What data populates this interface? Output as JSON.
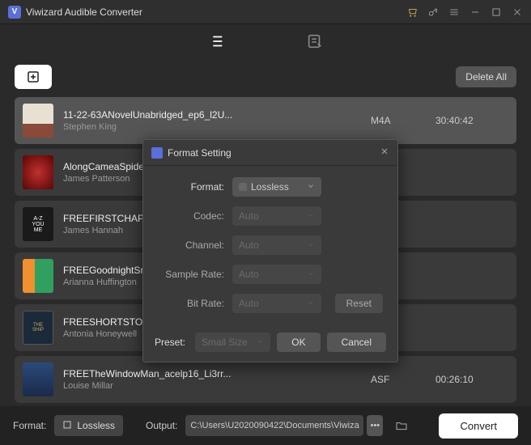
{
  "app": {
    "title": "Viwizard Audible Converter"
  },
  "actions": {
    "delete_all": "Delete All"
  },
  "list": [
    {
      "title": "11-22-63ANovelUnabridged_ep6_l2U...",
      "author": "Stephen King",
      "format": "M4A",
      "duration": "30:40:42",
      "thumb": "th1",
      "selected": true
    },
    {
      "title": "AlongCameaSpider",
      "author": "James Patterson",
      "format": "",
      "duration": "",
      "thumb": "th2"
    },
    {
      "title": "FREEFIRSTCHAPTER",
      "author": "James Hannah",
      "format": "",
      "duration": "",
      "thumb": "th3"
    },
    {
      "title": "FREEGoodnightSmartphone",
      "author": "Arianna Huffington",
      "format": "",
      "duration": "",
      "thumb": "th4"
    },
    {
      "title": "FREESHORTSTORY",
      "author": "Antonia Honeywell",
      "format": "",
      "duration": "",
      "thumb": "th5"
    },
    {
      "title": "FREETheWindowMan_acelp16_Li3rr...",
      "author": "Louise Millar",
      "format": "ASF",
      "duration": "00:26:10",
      "thumb": "th6"
    }
  ],
  "bottom": {
    "format_label": "Format:",
    "format_value": "Lossless",
    "output_label": "Output:",
    "output_path": "C:\\Users\\U2020090422\\Documents\\Viwiza",
    "convert": "Convert"
  },
  "modal": {
    "title": "Format Setting",
    "rows": {
      "format_label": "Format:",
      "format_value": "Lossless",
      "codec_label": "Codec:",
      "codec_value": "Auto",
      "channel_label": "Channel:",
      "channel_value": "Auto",
      "samplerate_label": "Sample Rate:",
      "samplerate_value": "Auto",
      "bitrate_label": "Bit Rate:",
      "bitrate_value": "Auto"
    },
    "reset": "Reset",
    "preset_label": "Preset:",
    "preset_value": "Small Size",
    "ok": "OK",
    "cancel": "Cancel"
  }
}
